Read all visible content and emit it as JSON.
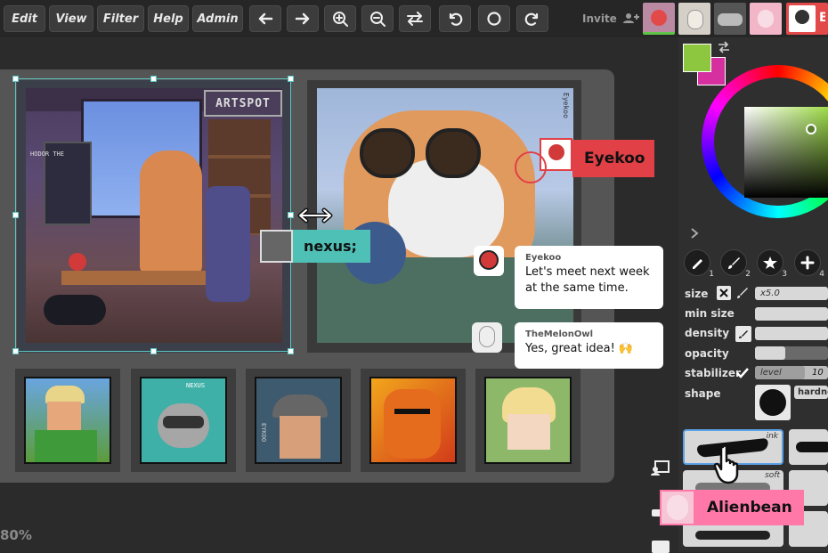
{
  "menu": {
    "edit": "Edit",
    "view": "View",
    "filter": "Filter",
    "help": "Help",
    "admin": "Admin"
  },
  "toolbar": {
    "icons": [
      "arrow-left-icon",
      "arrow-right-icon",
      "zoom-in-icon",
      "zoom-out-icon",
      "swap-icon",
      "undo-icon",
      "circle-icon",
      "redo-icon"
    ]
  },
  "invite": {
    "label": "Invite",
    "user_initial": "E"
  },
  "canvas": {
    "zoom_text": "80%",
    "artwork1_sign": "ARTSPOT",
    "artwork1_poster": "HODOR THE",
    "artwork2_sign": "Eyekoo",
    "thumb2_label": "NEXUS",
    "thumb3_label": "EYKOO"
  },
  "tags": {
    "eyekoo": "Eyekoo",
    "nexus": "nexus;",
    "alienbean": "Alienbean"
  },
  "chat": {
    "message1": {
      "name": "Eyekoo",
      "text": "Let's meet next week at the same time."
    },
    "message2": {
      "name": "TheMelonOwl",
      "text": "Yes, great idea! 🙌"
    }
  },
  "colors": {
    "primary": "#8dc63f",
    "secondary": "#d62fa0",
    "eyekoo_tag": "#e04046",
    "nexus_tag": "#4fc0b6",
    "alienbean_tag": "#ff78a8",
    "selection": "#5cc6c2"
  },
  "brush_tools": [
    {
      "icon": "pencil-icon",
      "num": "1"
    },
    {
      "icon": "brush-icon",
      "num": "2"
    },
    {
      "icon": "stamp-icon",
      "num": "3"
    },
    {
      "icon": "plus-icon",
      "num": "4"
    }
  ],
  "properties": {
    "size_label": "size",
    "size_value": "x5.0",
    "min_size_label": "min size",
    "density_label": "density",
    "opacity_label": "opacity",
    "stabilizer_label": "stabilizer",
    "stabilizer_name": "level",
    "stabilizer_value": "10",
    "shape_label": "shape",
    "shape_value": "hardness"
  },
  "brush_presets": {
    "ink": "ink",
    "soft": "soft"
  }
}
